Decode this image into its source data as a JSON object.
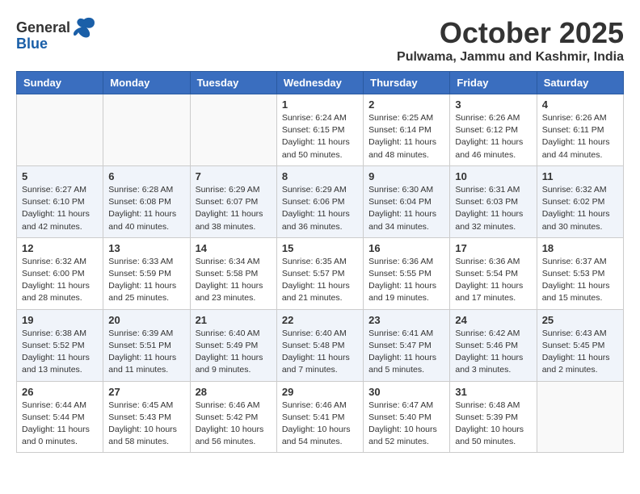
{
  "header": {
    "logo_general": "General",
    "logo_blue": "Blue",
    "month": "October 2025",
    "location": "Pulwama, Jammu and Kashmir, India"
  },
  "weekdays": [
    "Sunday",
    "Monday",
    "Tuesday",
    "Wednesday",
    "Thursday",
    "Friday",
    "Saturday"
  ],
  "weeks": [
    [
      {
        "day": "",
        "info": ""
      },
      {
        "day": "",
        "info": ""
      },
      {
        "day": "",
        "info": ""
      },
      {
        "day": "1",
        "info": "Sunrise: 6:24 AM\nSunset: 6:15 PM\nDaylight: 11 hours\nand 50 minutes."
      },
      {
        "day": "2",
        "info": "Sunrise: 6:25 AM\nSunset: 6:14 PM\nDaylight: 11 hours\nand 48 minutes."
      },
      {
        "day": "3",
        "info": "Sunrise: 6:26 AM\nSunset: 6:12 PM\nDaylight: 11 hours\nand 46 minutes."
      },
      {
        "day": "4",
        "info": "Sunrise: 6:26 AM\nSunset: 6:11 PM\nDaylight: 11 hours\nand 44 minutes."
      }
    ],
    [
      {
        "day": "5",
        "info": "Sunrise: 6:27 AM\nSunset: 6:10 PM\nDaylight: 11 hours\nand 42 minutes."
      },
      {
        "day": "6",
        "info": "Sunrise: 6:28 AM\nSunset: 6:08 PM\nDaylight: 11 hours\nand 40 minutes."
      },
      {
        "day": "7",
        "info": "Sunrise: 6:29 AM\nSunset: 6:07 PM\nDaylight: 11 hours\nand 38 minutes."
      },
      {
        "day": "8",
        "info": "Sunrise: 6:29 AM\nSunset: 6:06 PM\nDaylight: 11 hours\nand 36 minutes."
      },
      {
        "day": "9",
        "info": "Sunrise: 6:30 AM\nSunset: 6:04 PM\nDaylight: 11 hours\nand 34 minutes."
      },
      {
        "day": "10",
        "info": "Sunrise: 6:31 AM\nSunset: 6:03 PM\nDaylight: 11 hours\nand 32 minutes."
      },
      {
        "day": "11",
        "info": "Sunrise: 6:32 AM\nSunset: 6:02 PM\nDaylight: 11 hours\nand 30 minutes."
      }
    ],
    [
      {
        "day": "12",
        "info": "Sunrise: 6:32 AM\nSunset: 6:00 PM\nDaylight: 11 hours\nand 28 minutes."
      },
      {
        "day": "13",
        "info": "Sunrise: 6:33 AM\nSunset: 5:59 PM\nDaylight: 11 hours\nand 25 minutes."
      },
      {
        "day": "14",
        "info": "Sunrise: 6:34 AM\nSunset: 5:58 PM\nDaylight: 11 hours\nand 23 minutes."
      },
      {
        "day": "15",
        "info": "Sunrise: 6:35 AM\nSunset: 5:57 PM\nDaylight: 11 hours\nand 21 minutes."
      },
      {
        "day": "16",
        "info": "Sunrise: 6:36 AM\nSunset: 5:55 PM\nDaylight: 11 hours\nand 19 minutes."
      },
      {
        "day": "17",
        "info": "Sunrise: 6:36 AM\nSunset: 5:54 PM\nDaylight: 11 hours\nand 17 minutes."
      },
      {
        "day": "18",
        "info": "Sunrise: 6:37 AM\nSunset: 5:53 PM\nDaylight: 11 hours\nand 15 minutes."
      }
    ],
    [
      {
        "day": "19",
        "info": "Sunrise: 6:38 AM\nSunset: 5:52 PM\nDaylight: 11 hours\nand 13 minutes."
      },
      {
        "day": "20",
        "info": "Sunrise: 6:39 AM\nSunset: 5:51 PM\nDaylight: 11 hours\nand 11 minutes."
      },
      {
        "day": "21",
        "info": "Sunrise: 6:40 AM\nSunset: 5:49 PM\nDaylight: 11 hours\nand 9 minutes."
      },
      {
        "day": "22",
        "info": "Sunrise: 6:40 AM\nSunset: 5:48 PM\nDaylight: 11 hours\nand 7 minutes."
      },
      {
        "day": "23",
        "info": "Sunrise: 6:41 AM\nSunset: 5:47 PM\nDaylight: 11 hours\nand 5 minutes."
      },
      {
        "day": "24",
        "info": "Sunrise: 6:42 AM\nSunset: 5:46 PM\nDaylight: 11 hours\nand 3 minutes."
      },
      {
        "day": "25",
        "info": "Sunrise: 6:43 AM\nSunset: 5:45 PM\nDaylight: 11 hours\nand 2 minutes."
      }
    ],
    [
      {
        "day": "26",
        "info": "Sunrise: 6:44 AM\nSunset: 5:44 PM\nDaylight: 11 hours\nand 0 minutes."
      },
      {
        "day": "27",
        "info": "Sunrise: 6:45 AM\nSunset: 5:43 PM\nDaylight: 10 hours\nand 58 minutes."
      },
      {
        "day": "28",
        "info": "Sunrise: 6:46 AM\nSunset: 5:42 PM\nDaylight: 10 hours\nand 56 minutes."
      },
      {
        "day": "29",
        "info": "Sunrise: 6:46 AM\nSunset: 5:41 PM\nDaylight: 10 hours\nand 54 minutes."
      },
      {
        "day": "30",
        "info": "Sunrise: 6:47 AM\nSunset: 5:40 PM\nDaylight: 10 hours\nand 52 minutes."
      },
      {
        "day": "31",
        "info": "Sunrise: 6:48 AM\nSunset: 5:39 PM\nDaylight: 10 hours\nand 50 minutes."
      },
      {
        "day": "",
        "info": ""
      }
    ]
  ]
}
